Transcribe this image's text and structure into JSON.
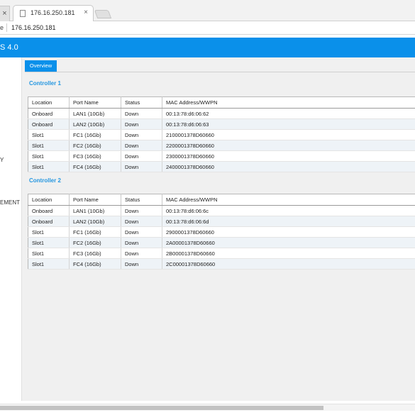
{
  "browser": {
    "prev_tab_close": "×",
    "active_tab": {
      "title": "176.16.250.181",
      "close": "×"
    },
    "address": {
      "prefix": "e",
      "url": "176.16.250.181"
    }
  },
  "app": {
    "title": "S 4.0",
    "accent": "#0a90ea"
  },
  "sidebar": {
    "items": [
      {
        "label": "Y"
      },
      {
        "label": "EMENT"
      }
    ]
  },
  "main": {
    "tab_label": "Overview",
    "columns": [
      "Location",
      "Port Name",
      "Status",
      "MAC Address/WWPN"
    ],
    "controllers": [
      {
        "title": "Controller 1",
        "rows": [
          [
            "Onboard",
            "LAN1 (10Gb)",
            "Down",
            "00:13:78:d6:06:62"
          ],
          [
            "Onboard",
            "LAN2 (10Gb)",
            "Down",
            "00:13:78:d6:06:63"
          ],
          [
            "Slot1",
            "FC1 (16Gb)",
            "Down",
            "2100001378D60660"
          ],
          [
            "Slot1",
            "FC2 (16Gb)",
            "Down",
            "2200001378D60660"
          ],
          [
            "Slot1",
            "FC3 (16Gb)",
            "Down",
            "2300001378D60660"
          ],
          [
            "Slot1",
            "FC4 (16Gb)",
            "Down",
            "2400001378D60660"
          ]
        ]
      },
      {
        "title": "Controller 2",
        "rows": [
          [
            "Onboard",
            "LAN1 (10Gb)",
            "Down",
            "00:13:78:d6:06:6c"
          ],
          [
            "Onboard",
            "LAN2 (10Gb)",
            "Down",
            "00:13:78:d6:06:6d"
          ],
          [
            "Slot1",
            "FC1 (16Gb)",
            "Down",
            "2900001378D60660"
          ],
          [
            "Slot1",
            "FC2 (16Gb)",
            "Down",
            "2A00001378D60660"
          ],
          [
            "Slot1",
            "FC3 (16Gb)",
            "Down",
            "2B00001378D60660"
          ],
          [
            "Slot1",
            "FC4 (16Gb)",
            "Down",
            "2C00001378D60660"
          ]
        ]
      }
    ]
  }
}
